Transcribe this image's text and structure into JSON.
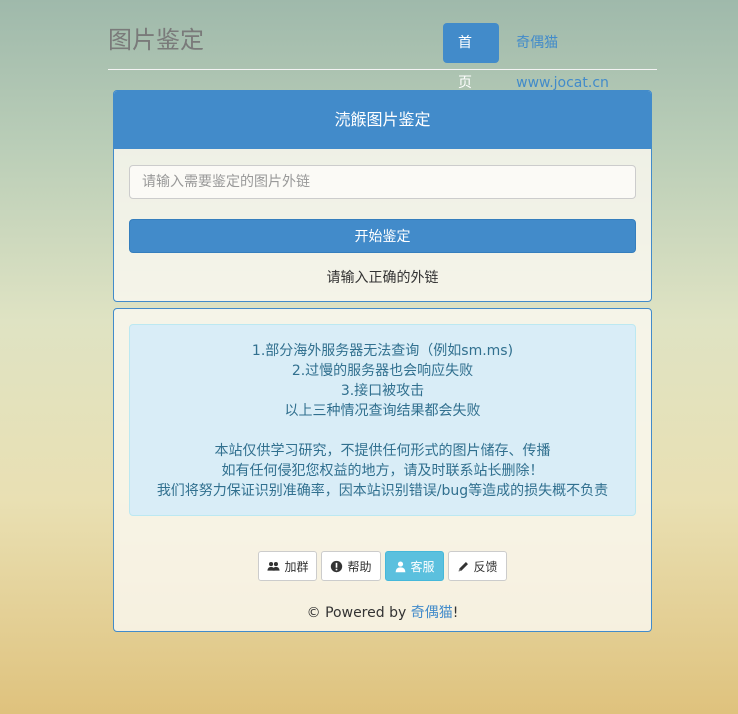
{
  "header": {
    "title": "图片鉴定",
    "nav": {
      "home_label": "首页",
      "link_label": "奇偶猫www.jocat.cn"
    }
  },
  "main_panel": {
    "heading": "涜餱图片鉴定",
    "input_placeholder": "请输入需要鉴定的图片外链",
    "input_value": "",
    "start_button_label": "开始鉴定",
    "hint": "请输入正确的外链"
  },
  "notice": {
    "lines": [
      "1.部分海外服务器无法查询（例如sm.ms)",
      "2.过慢的服务器也会响应失败",
      "3.接口被攻击",
      "以上三种情况查询结果都会失败"
    ],
    "disclaimer": [
      "本站仅供学习研究，不提供任何形式的图片储存、传播",
      "如有任何侵犯您权益的地方，请及时联系站长删除！",
      "我们将努力保证识别准确率，因本站识别错误/bug等造成的损失概不负责"
    ]
  },
  "buttons": [
    {
      "label": "加群",
      "icon": "users-icon"
    },
    {
      "label": "帮助",
      "icon": "exclamation-circle-icon"
    },
    {
      "label": "客服",
      "icon": "user-icon",
      "active": true
    },
    {
      "label": "反馈",
      "icon": "pencil-icon"
    }
  ],
  "footer": {
    "prefix": "© Powered by ",
    "brand": "奇偶猫",
    "suffix": "!"
  },
  "colors": {
    "primary": "#428bca",
    "info_bg": "#d9edf7",
    "info_text": "#31708f",
    "active_button": "#5bc0de"
  }
}
